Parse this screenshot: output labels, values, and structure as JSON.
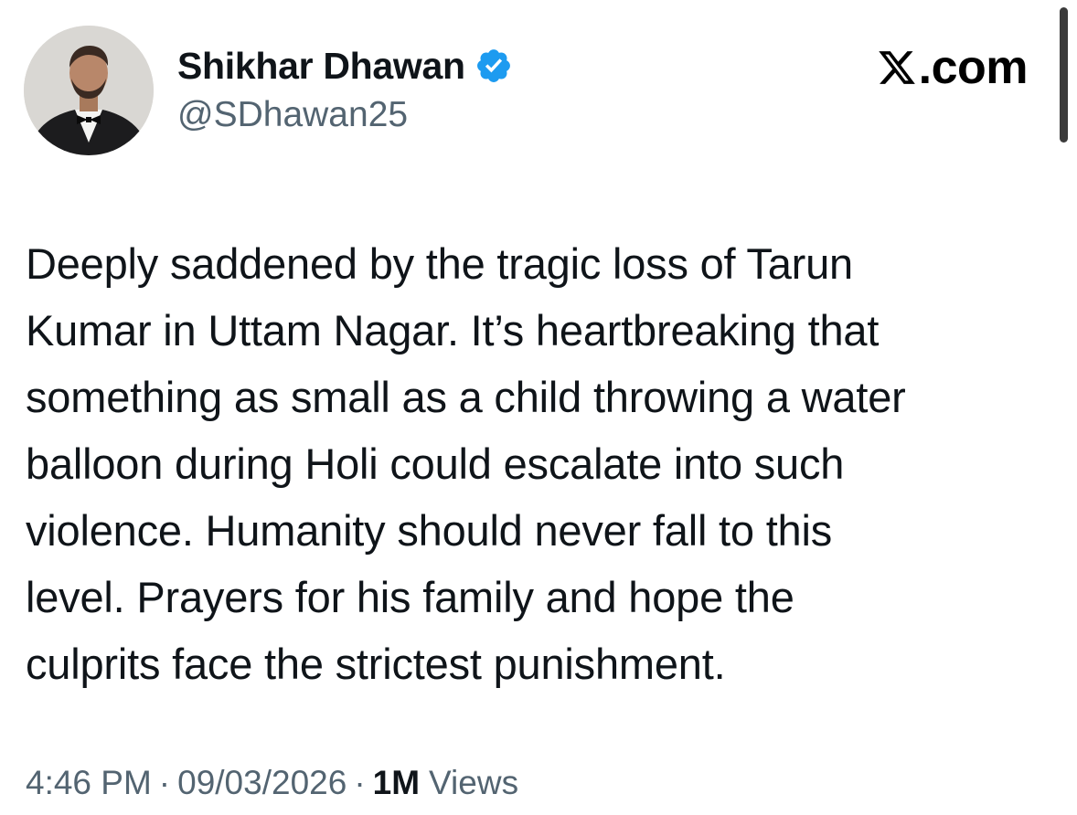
{
  "author": {
    "display_name": "Shikhar Dhawan",
    "handle": "@SDhawan25",
    "verified": true,
    "verified_color": "#1d9bf0"
  },
  "brand": {
    "label": ".com",
    "icon": "x-logo-icon"
  },
  "tweet": {
    "lines": [
      "Deeply saddened by the tragic loss of Tarun",
      "Kumar in Uttam Nagar. It’s heartbreaking that",
      "something as small as a child throwing a water",
      "balloon during Holi could escalate into such",
      "violence. Humanity should never fall to this",
      "level. Prayers for his family and hope the",
      "culprits face the strictest punishment."
    ]
  },
  "meta": {
    "time": "4:46 PM",
    "separator": "·",
    "date": "09/03/2026",
    "views_count": "1M",
    "views_label": "Views"
  }
}
